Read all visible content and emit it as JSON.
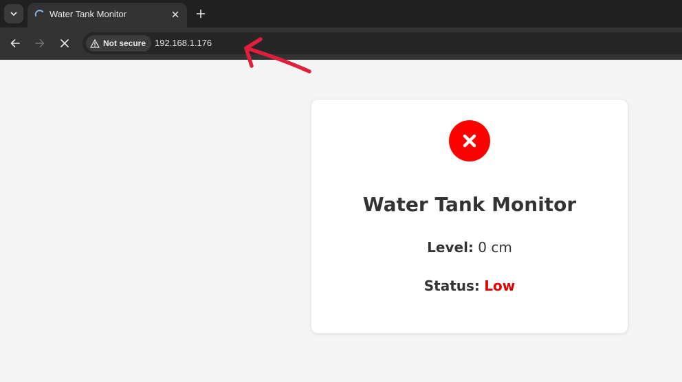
{
  "browser": {
    "tab": {
      "title": "Water Tank Monitor"
    },
    "security_chip_label": "Not secure",
    "url": "192.168.1.176",
    "annotation_arrow_color": "#e0203a"
  },
  "page": {
    "status_icon": "x-circle-icon",
    "status_icon_color": "#ff0000",
    "title": "Water Tank Monitor",
    "level_label": "Level:",
    "level_value": "0 cm",
    "status_label": "Status:",
    "status_value": "Low",
    "status_value_color": "#e00000"
  }
}
